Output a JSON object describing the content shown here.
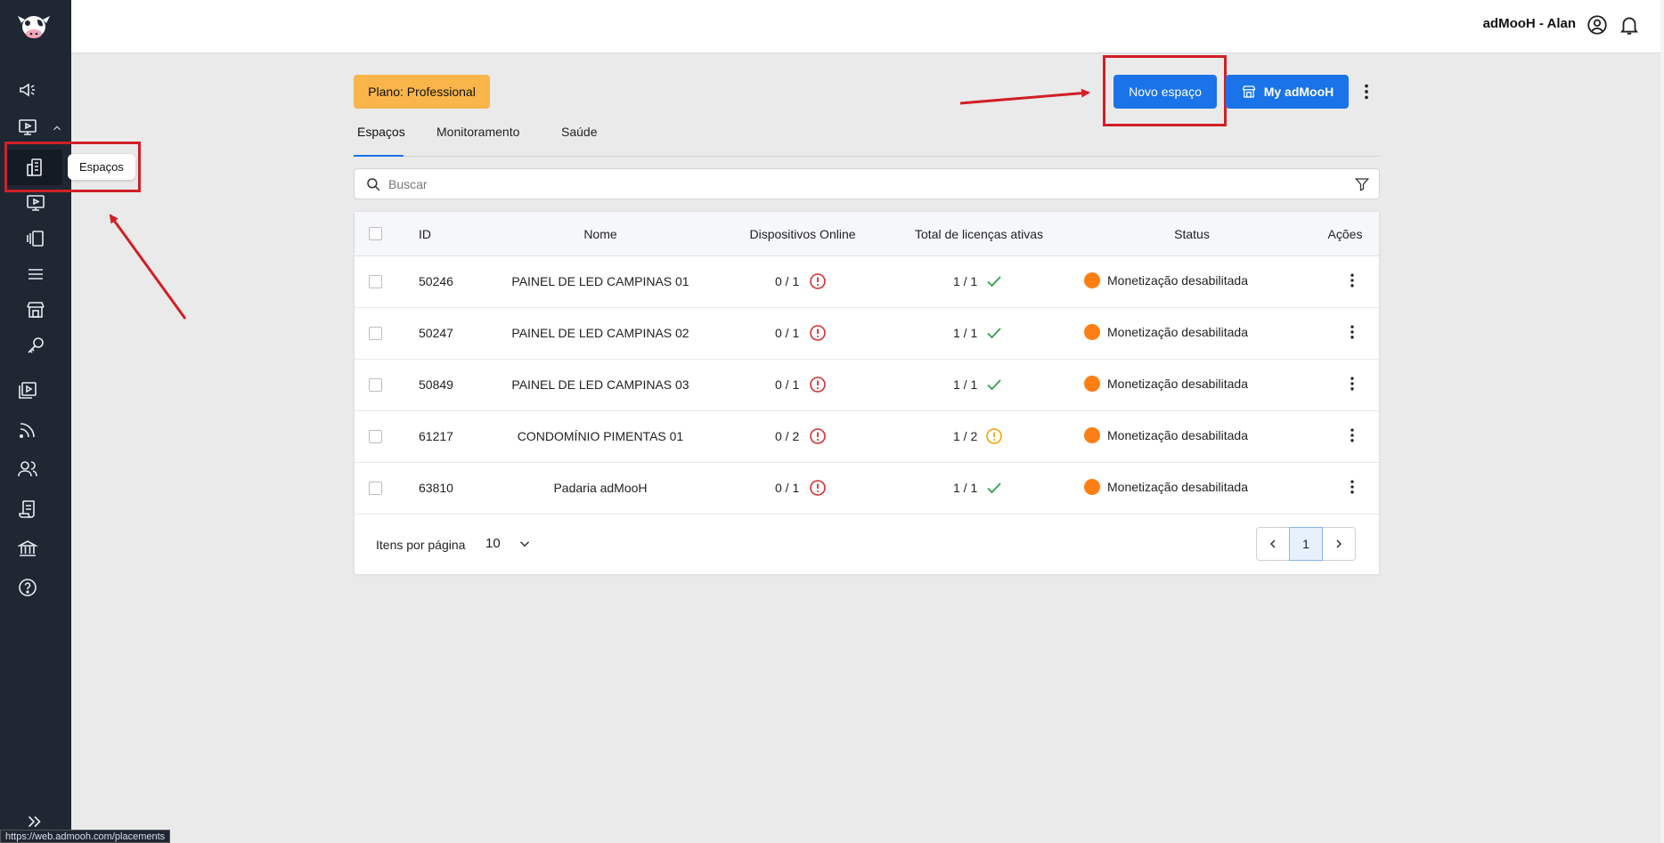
{
  "user": {
    "name": "adMooH - Alan"
  },
  "sidebar": {
    "tooltip": "Espaços",
    "icons": [
      "megaphone-icon",
      "screen-play-icon",
      "building-icon",
      "screen-play-small-icon",
      "carousel-icon",
      "list-icon",
      "store-icon",
      "key-icon",
      "media-library-icon",
      "feed-icon",
      "users-icon",
      "contract-icon",
      "bank-icon",
      "help-icon"
    ]
  },
  "header": {
    "plan": "Plano: Professional",
    "new_space": "Novo espaço",
    "my_admooh": "My adMooH"
  },
  "tabs": [
    {
      "label": "Espaços"
    },
    {
      "label": "Monitoramento"
    },
    {
      "label": "Saúde"
    }
  ],
  "search": {
    "placeholder": "Buscar"
  },
  "table": {
    "columns": [
      "ID",
      "Nome",
      "Dispositivos Online",
      "Total de licenças ativas",
      "Status",
      "Ações"
    ],
    "rows": [
      {
        "id": "50246",
        "name": "PAINEL DE LED CAMPINAS 01",
        "devices": "0 / 1",
        "devices_state": "error",
        "licenses": "1 / 1",
        "licenses_state": "ok",
        "status": "Monetização desabilitada"
      },
      {
        "id": "50247",
        "name": "PAINEL DE LED CAMPINAS 02",
        "devices": "0 / 1",
        "devices_state": "error",
        "licenses": "1 / 1",
        "licenses_state": "ok",
        "status": "Monetização desabilitada"
      },
      {
        "id": "50849",
        "name": "PAINEL DE LED CAMPINAS 03",
        "devices": "0 / 1",
        "devices_state": "error",
        "licenses": "1 / 1",
        "licenses_state": "ok",
        "status": "Monetização desabilitada"
      },
      {
        "id": "61217",
        "name": "CONDOMÍNIO PIMENTAS 01",
        "devices": "0 / 2",
        "devices_state": "error",
        "licenses": "1 / 2",
        "licenses_state": "warning",
        "status": "Monetização desabilitada"
      },
      {
        "id": "63810",
        "name": "Padaria adMooH",
        "devices": "0 / 1",
        "devices_state": "error",
        "licenses": "1 / 1",
        "licenses_state": "ok",
        "status": "Monetização desabilitada"
      }
    ]
  },
  "footer": {
    "items_per_page_label": "Itens por página",
    "items_per_page": "10",
    "current_page": "1"
  },
  "statusbar": "https://web.admooh.com/placements",
  "colors": {
    "sidebar": "#1f2733",
    "primary": "#1a73e8",
    "plan_badge": "#f9b54a",
    "status_dot": "#fd7e14",
    "error": "#d32f2f",
    "ok": "#2e9e44",
    "warning": "#f0a500",
    "annotation": "#d11f26"
  }
}
